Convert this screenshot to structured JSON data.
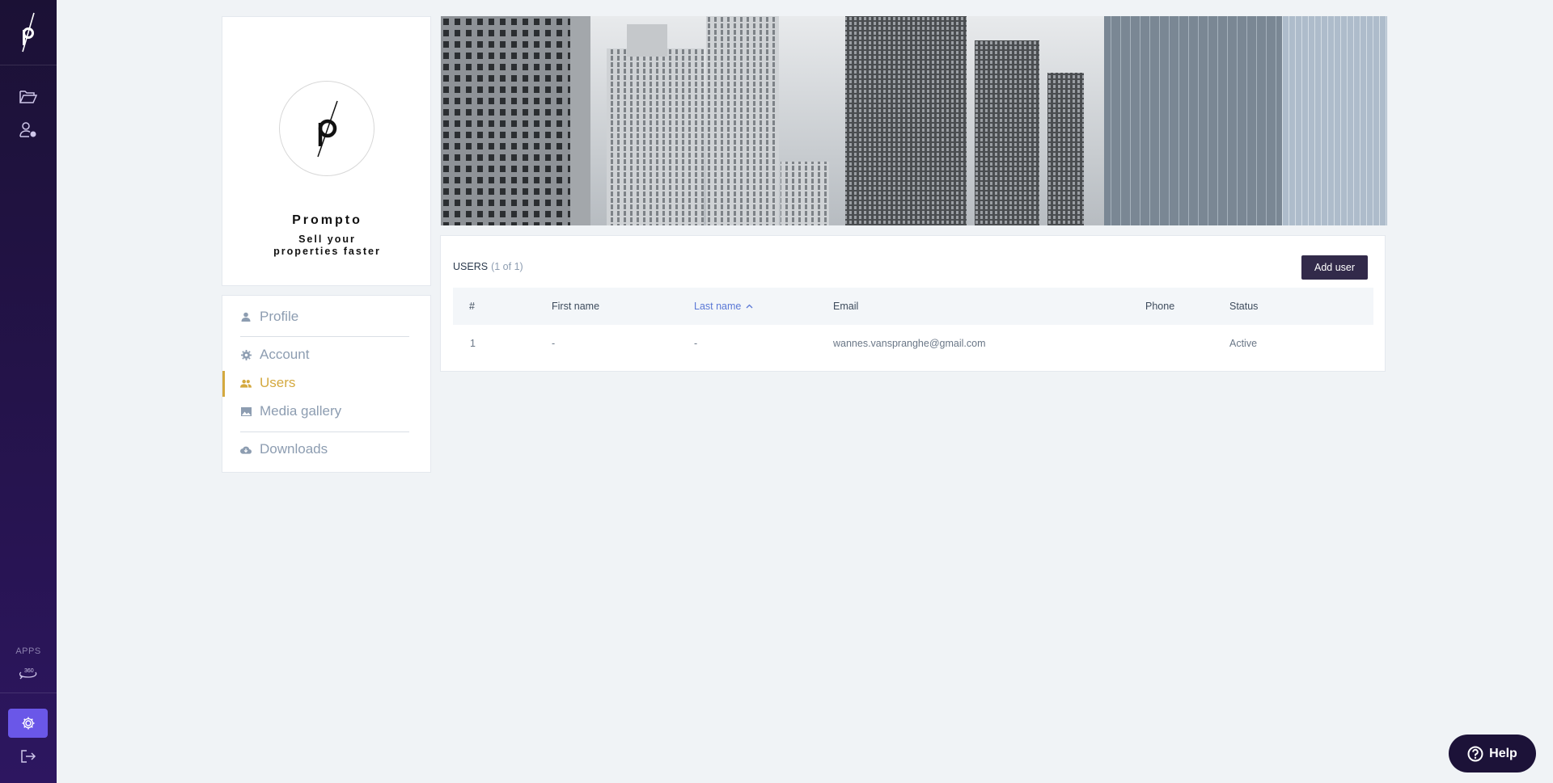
{
  "rail": {
    "apps_label": "APPS",
    "icons": [
      "logo-icon",
      "folder-icon",
      "user-settings-icon",
      "360-view-icon",
      "gear-icon",
      "logout-icon"
    ]
  },
  "company": {
    "name": "Prompto",
    "tagline_line1": "Sell your",
    "tagline_line2": "properties faster"
  },
  "menu": {
    "items": [
      {
        "label": "Profile",
        "icon": "person-icon"
      },
      {
        "label": "Account",
        "icon": "gear-icon"
      },
      {
        "label": "Users",
        "icon": "people-icon",
        "active": true
      },
      {
        "label": "Media gallery",
        "icon": "image-icon"
      },
      {
        "label": "Downloads",
        "icon": "cloud-download-icon"
      }
    ]
  },
  "users": {
    "title": "USERS",
    "count": "(1 of 1)",
    "add_button": "Add user",
    "columns": [
      "#",
      "First name",
      "Last name",
      "Email",
      "Phone",
      "Status"
    ],
    "sorted_column": "Last name",
    "rows": [
      {
        "index": "1",
        "first_name": "-",
        "last_name": "-",
        "email": "wannes.vanspranghe@gmail.com",
        "phone": "",
        "status": "Active"
      }
    ]
  },
  "help": {
    "label": "Help"
  },
  "colors": {
    "accent": "#6a57e8",
    "active_menu": "#d4a93f",
    "rail_bg": "#24134a",
    "button_dark": "#322a4a"
  }
}
